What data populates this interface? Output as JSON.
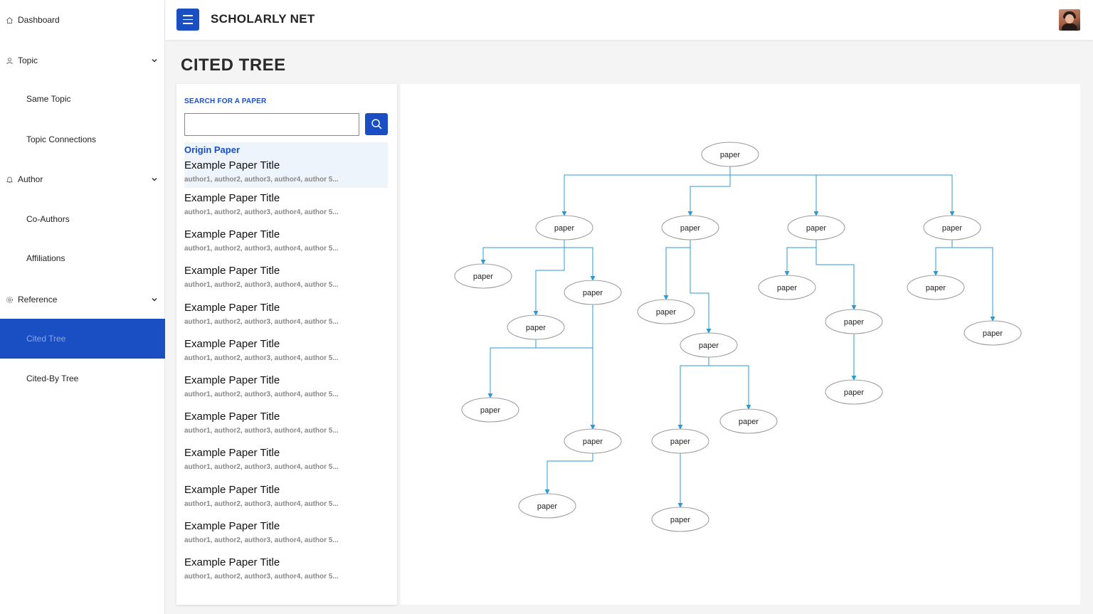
{
  "sidebar": {
    "dashboard": "Dashboard",
    "topic": "Topic",
    "same_topic": "Same Topic",
    "topic_connections": "Topic Connections",
    "author": "Author",
    "co_authors": "Co-Authors",
    "affiliations": "Affiliations",
    "reference": "Reference",
    "cited_tree": "Cited Tree",
    "cited_by_tree": "Cited-By Tree"
  },
  "header": {
    "brand": "SCHOLARLY NET"
  },
  "page": {
    "title": "CITED TREE"
  },
  "search": {
    "label": "SEARCH FOR A PAPER",
    "value": "",
    "placeholder": ""
  },
  "origin_label": "Origin Paper",
  "papers": [
    {
      "title": "Example Paper Title",
      "authors": "author1, author2, author3, author4, author 5..."
    },
    {
      "title": "Example Paper Title",
      "authors": "author1, author2, author3, author4, author 5..."
    },
    {
      "title": "Example Paper Title",
      "authors": "author1, author2, author3, author4, author 5..."
    },
    {
      "title": "Example Paper Title",
      "authors": "author1, author2, author3, author4, author 5..."
    },
    {
      "title": "Example Paper Title",
      "authors": "author1, author2, author3, author4, author 5..."
    },
    {
      "title": "Example Paper Title",
      "authors": "author1, author2, author3, author4, author 5..."
    },
    {
      "title": "Example Paper Title",
      "authors": "author1, author2, author3, author4, author 5..."
    },
    {
      "title": "Example Paper Title",
      "authors": "author1, author2, author3, author4, author 5..."
    },
    {
      "title": "Example Paper Title",
      "authors": "author1, author2, author3, author4, author 5..."
    },
    {
      "title": "Example Paper Title",
      "authors": "author1, author2, author3, author4, author 5..."
    },
    {
      "title": "Example Paper Title",
      "authors": "author1, author2, author3, author4, author 5..."
    },
    {
      "title": "Example Paper Title",
      "authors": "author1, author2, author3, author4, author 5..."
    }
  ],
  "tree": {
    "node_label": "paper",
    "edge_color": "#2a9ad6"
  },
  "colors": {
    "accent": "#1a4fc4"
  }
}
